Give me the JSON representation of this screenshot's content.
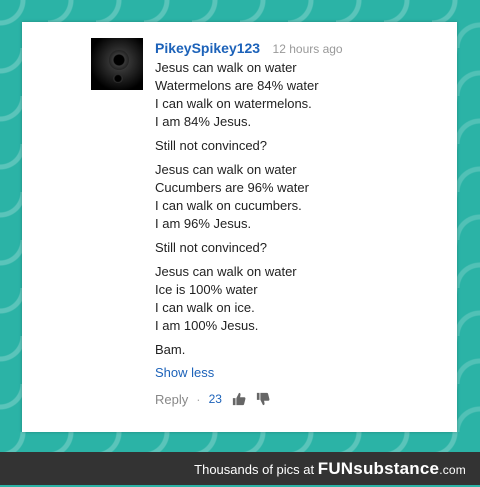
{
  "comment": {
    "username": "PikeySpikey123",
    "timestamp": "12 hours ago",
    "paragraphs": [
      [
        "Jesus can walk on water",
        "Watermelons are 84% water",
        "I can walk on watermelons.",
        "I am 84% Jesus."
      ],
      [
        "Still not convinced?"
      ],
      [
        "Jesus can walk on water",
        "Cucumbers are 96% water",
        "I can walk on cucumbers.",
        "I am 96% Jesus."
      ],
      [
        "Still not convinced?"
      ],
      [
        "Jesus can walk on water",
        "Ice is 100% water",
        "I can walk on ice.",
        "I am 100% Jesus."
      ],
      [
        "Bam."
      ]
    ],
    "show_less": "Show less",
    "reply_label": "Reply",
    "separator": "·",
    "like_count": "23"
  },
  "icons": {
    "thumbs_up": "thumbs-up-icon",
    "thumbs_down": "thumbs-down-icon"
  },
  "footer": {
    "text": "Thousands of pics at",
    "brand_fun": "FUN",
    "brand_sub": "substance",
    "brand_com": ".com"
  },
  "colors": {
    "background_teal": "#2bb3a6",
    "username_blue": "#1c62b9",
    "footer_bar": "#333333"
  }
}
